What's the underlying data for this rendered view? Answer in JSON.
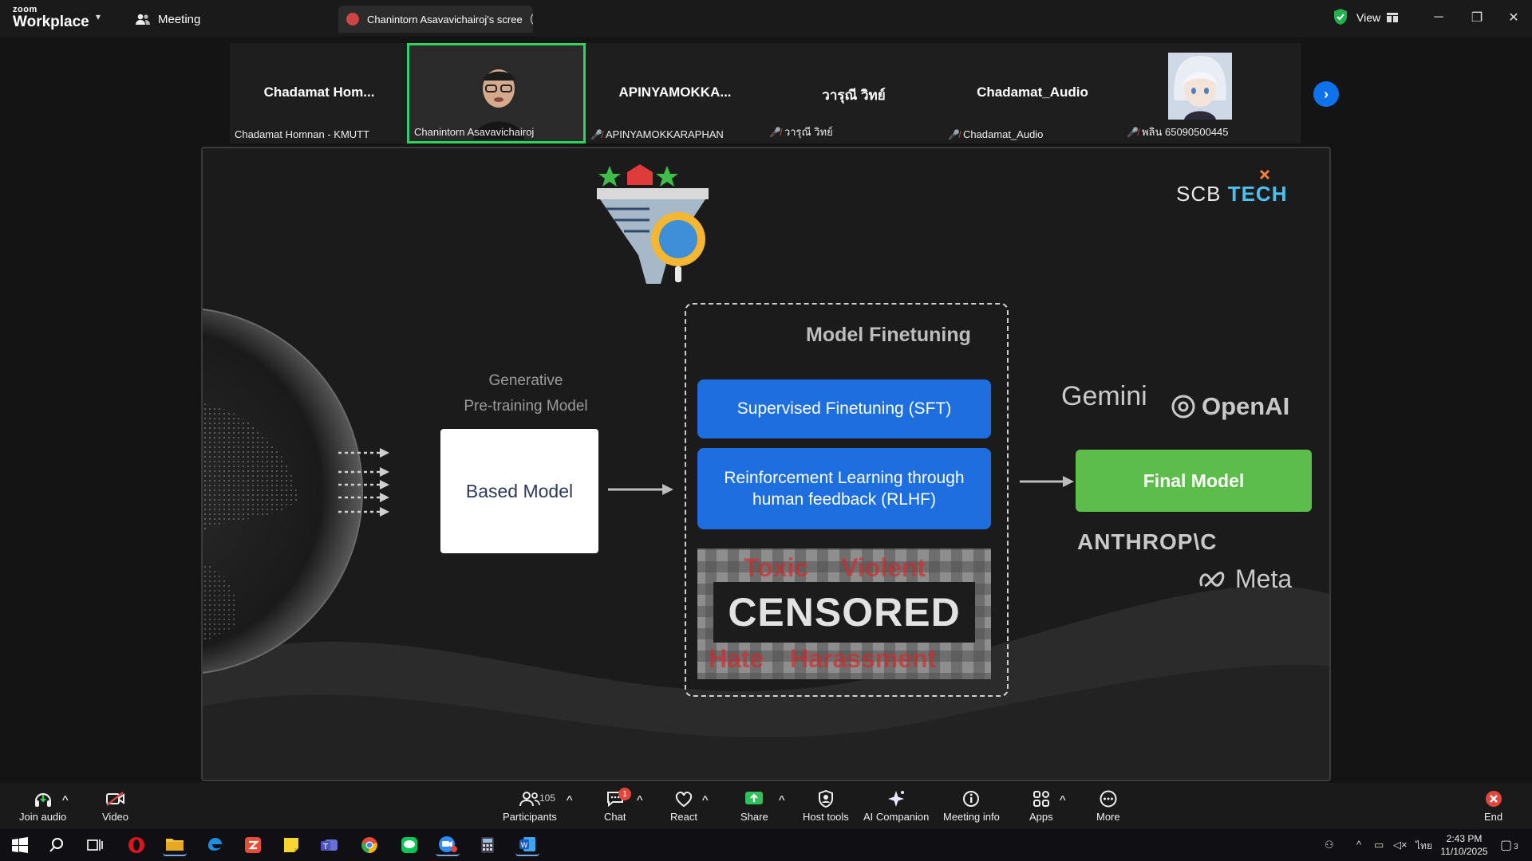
{
  "app": {
    "logo_line1": "zoom",
    "logo_line2": "Workplace",
    "meeting_menu": "Meeting",
    "share_tab_title": "Chanintorn Asavavichairoj's scree",
    "view_label": "View"
  },
  "participants": [
    {
      "display_name": "Chadamat  Hom...",
      "label": "Chadamat Homnan - KMUTT",
      "muted": false,
      "video": false
    },
    {
      "display_name": "",
      "label": "Chanintorn Asavavichairoj",
      "muted": false,
      "video": true,
      "active": true
    },
    {
      "display_name": "APINYAMOKKA...",
      "label": "APINYAMOKKARAPHAN",
      "muted": true,
      "video": false
    },
    {
      "display_name": "วารุณี วิทย์",
      "label": "วารุณี วิทย์",
      "muted": true,
      "video": false
    },
    {
      "display_name": "Chadamat_Audio",
      "label": "Chadamat_Audio",
      "muted": true,
      "video": false
    },
    {
      "display_name": "",
      "label": "พลิน 65090500445",
      "muted": true,
      "video": false,
      "avatar": "anime-avatar"
    }
  ],
  "slide": {
    "brand_scb": "SCB",
    "brand_tech": "TECH",
    "gen_label_line1": "Generative",
    "gen_label_line2": "Pre-training Model",
    "based_model": "Based Model",
    "finetuning_title": "Model Finetuning",
    "sft": "Supervised Finetuning (SFT)",
    "rlhf": "Reinforcement Learning through human feedback (RLHF)",
    "censored": "CENSORED",
    "censor_words": [
      "Toxic",
      "Violent",
      "Hate",
      "Harassment"
    ],
    "final_model": "Final Model",
    "brands": {
      "gemini": "Gemini",
      "openai": "OpenAI",
      "anthropic": "ANTHROP\\C",
      "meta": "Meta"
    }
  },
  "toolbar": {
    "join_audio": "Join audio",
    "video": "Video",
    "participants": "Participants",
    "participants_count": "105",
    "chat": "Chat",
    "chat_badge": "1",
    "react": "React",
    "share": "Share",
    "host_tools": "Host tools",
    "ai_companion": "AI Companion",
    "meeting_info": "Meeting info",
    "apps": "Apps",
    "more": "More",
    "end": "End"
  },
  "taskbar": {
    "time": "2:43 PM",
    "date": "11/10/2025",
    "lang": "ไทย",
    "notif_count": "3",
    "zoom_badge": "1"
  },
  "colors": {
    "accent_blue": "#0e72ed",
    "active_green": "#31d45a",
    "sft_blue": "#1d6fe0",
    "final_green": "#5cbd4a",
    "mute_red": "#e0463e"
  }
}
